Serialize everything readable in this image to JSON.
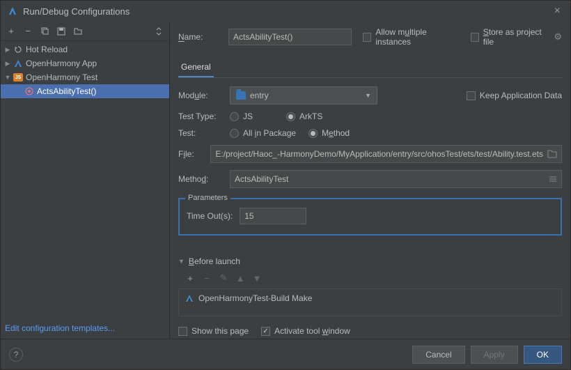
{
  "title": "Run/Debug Configurations",
  "sidebar": {
    "items": [
      {
        "label": "Hot Reload",
        "icon": "reload",
        "expanded": false
      },
      {
        "label": "OpenHarmony App",
        "icon": "A",
        "expanded": false
      },
      {
        "label": "OpenHarmony Test",
        "icon": "JS",
        "expanded": true
      },
      {
        "label": "ActsAbilityTest()",
        "icon": "o",
        "selected": true
      }
    ],
    "footer_link": "Edit configuration templates..."
  },
  "form": {
    "name_label": "Name:",
    "name_value": "ActsAbilityTest()",
    "allow_multiple": "Allow multiple instances",
    "store_as_project": "Store as project file",
    "tabs": {
      "general": "General"
    },
    "module_label": "Module:",
    "module_value": "entry",
    "keep_app_data": "Keep Application Data",
    "test_type_label": "Test Type:",
    "test_type_options": {
      "js": "JS",
      "arkts": "ArkTS"
    },
    "test_label": "Test:",
    "test_options": {
      "all": "All in Package",
      "method": "Method"
    },
    "file_label": "File:",
    "file_value": "E:/project/Haoc_-HarmonyDemo/MyApplication/entry/src/ohosTest/ets/test/Ability.test.ets",
    "method_label": "Method:",
    "method_value": "ActsAbilityTest",
    "params_legend": "Parameters",
    "timeout_label": "Time Out(s):",
    "timeout_value": "15",
    "before_launch": "Before launch",
    "before_item": "OpenHarmonyTest-Build Make",
    "show_page": "Show this page",
    "activate_window": "Activate tool window"
  },
  "footer": {
    "cancel": "Cancel",
    "apply": "Apply",
    "ok": "OK"
  }
}
